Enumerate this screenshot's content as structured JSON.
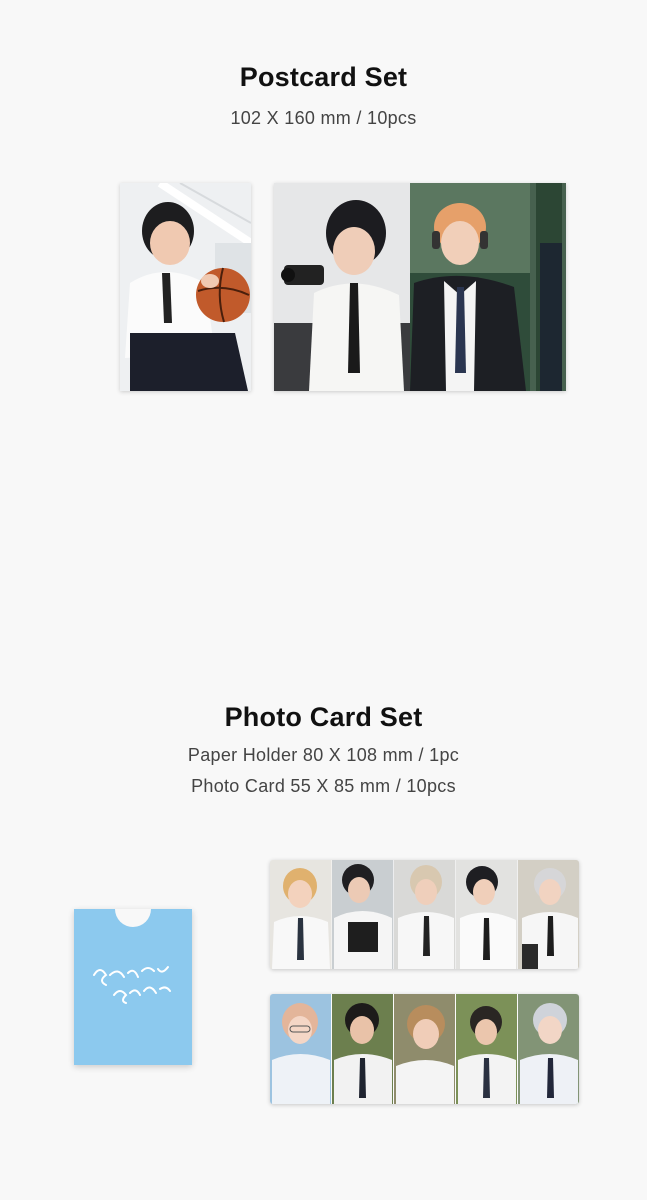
{
  "postcard": {
    "title": "Postcard Set",
    "spec": "102 X 160 mm / 10pcs"
  },
  "photocard": {
    "title": "Photo Card Set",
    "spec_holder": "Paper Holder 80 X 108 mm / 1pc",
    "spec_card": "Photo Card 55 X 85 mm / 10pcs"
  },
  "colors": {
    "background": "#f8f8f8",
    "holder_blue": "#8cc9ee",
    "title": "#111111",
    "subtitle": "#444444"
  }
}
